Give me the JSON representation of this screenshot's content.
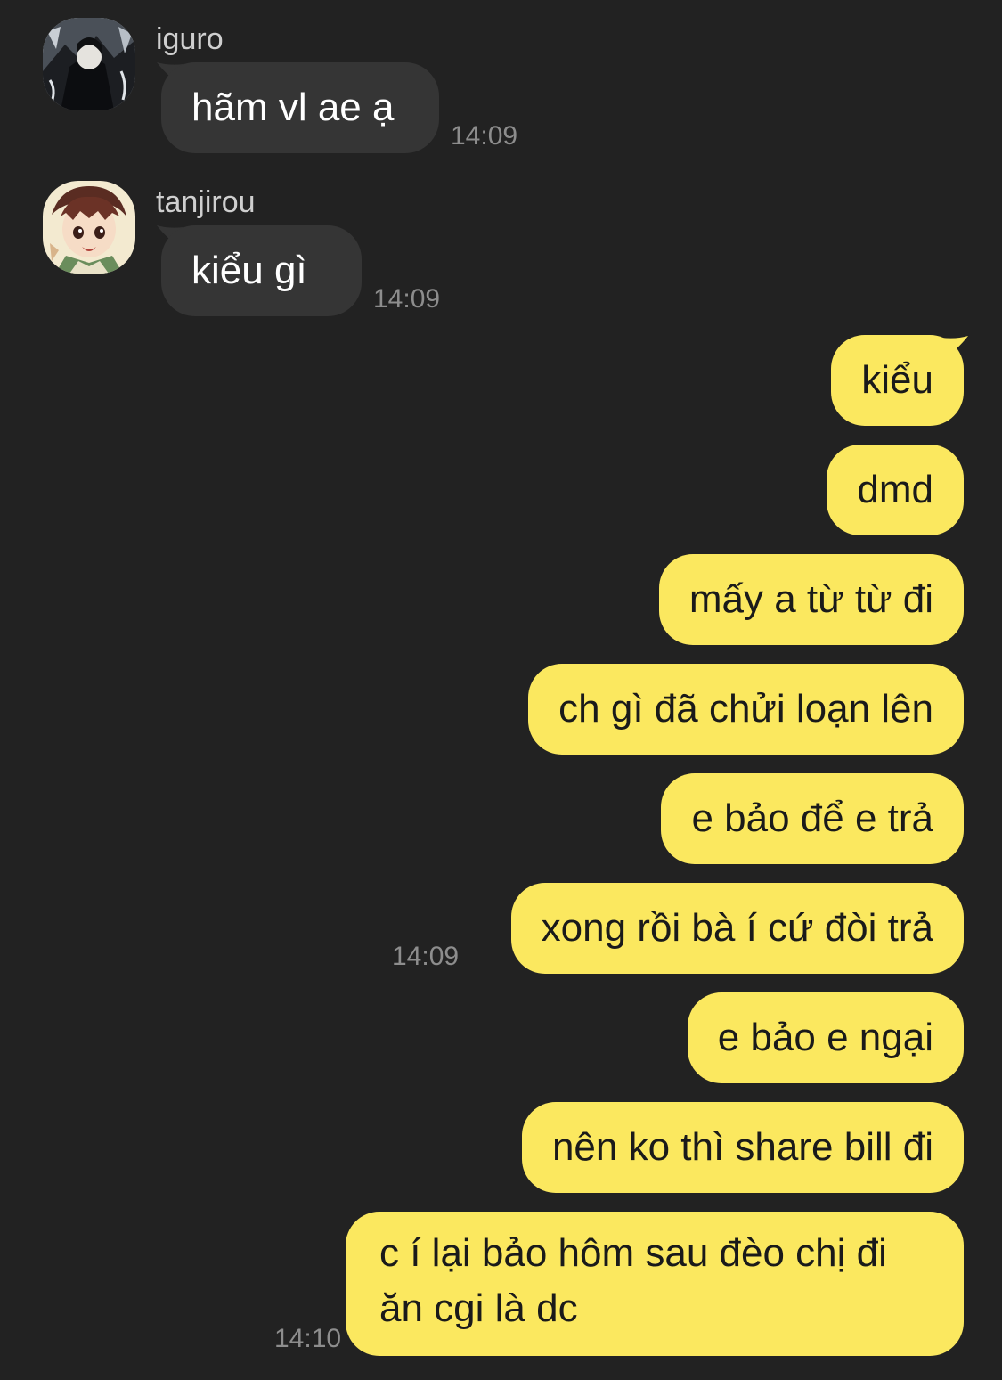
{
  "messages_in": [
    {
      "sender": "iguro",
      "text": "hãm vl ae ạ",
      "time": "14:09",
      "avatar_icon": "iguro-avatar-icon"
    },
    {
      "sender": "tanjirou",
      "text": "kiểu gì",
      "time": "14:09",
      "avatar_icon": "tanjirou-avatar-icon"
    }
  ],
  "messages_out": [
    {
      "text": "kiểu"
    },
    {
      "text": "dmd"
    },
    {
      "text": "mấy a từ từ đi"
    },
    {
      "text": "ch gì đã chửi loạn lên"
    },
    {
      "text": "e bảo để e trả"
    },
    {
      "text": "xong rồi bà í cứ đòi trả",
      "time": "14:09"
    },
    {
      "text": "e bảo e ngại"
    },
    {
      "text": "nên ko thì share bill đi"
    },
    {
      "text": "c í lại bảo hôm sau đèo chị đi ăn cgi là dc",
      "time": "14:10"
    }
  ],
  "colors": {
    "background": "#222222",
    "incoming_bubble": "#353535",
    "outgoing_bubble": "#fbe85f",
    "timestamp": "#8d8d8d"
  }
}
